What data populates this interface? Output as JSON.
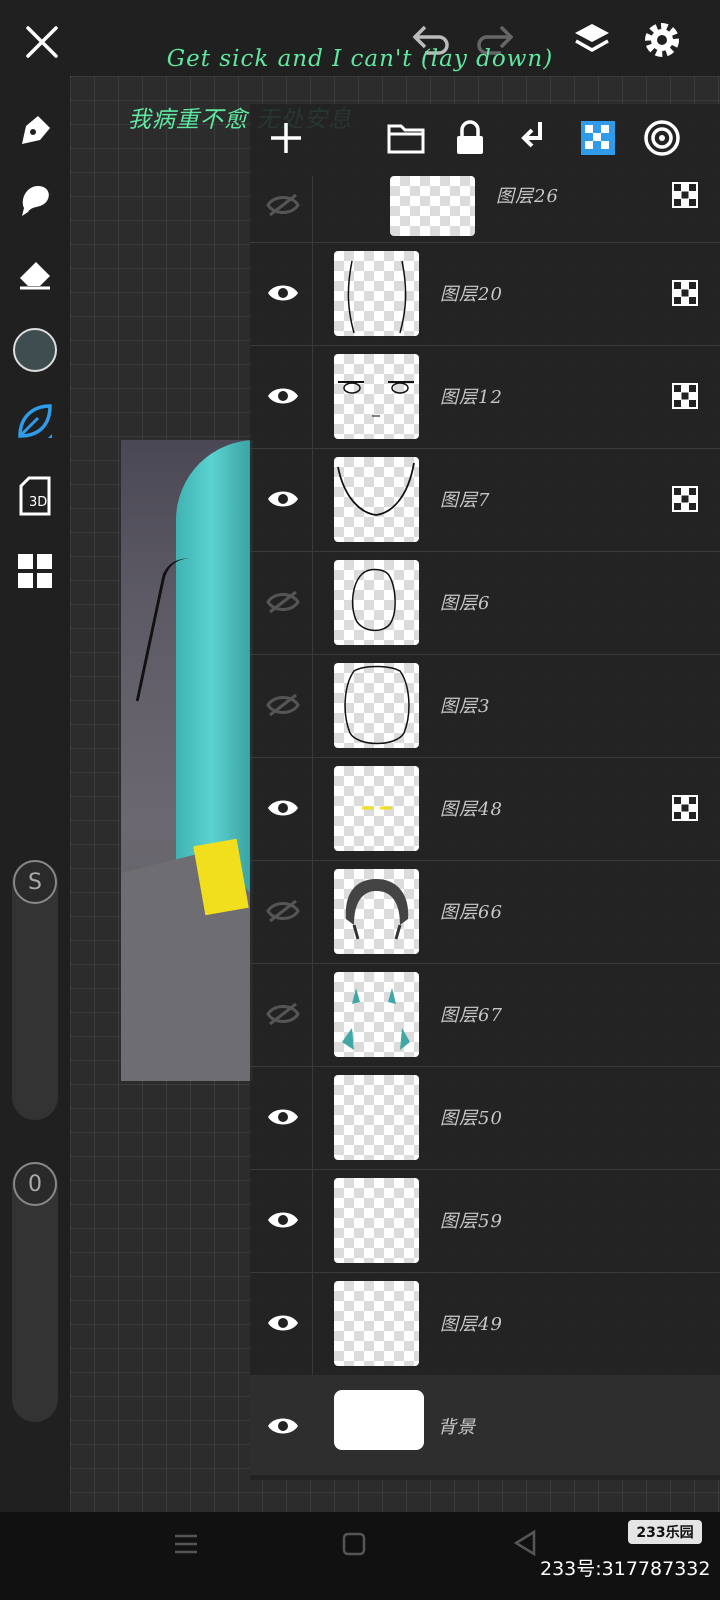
{
  "caption": {
    "english": "Get sick and I can't (lay down)",
    "chinese": "我病重不愈 无处安息"
  },
  "left_toolbar": {
    "current_color": "#3e4d50",
    "size_slider_label": "S",
    "opacity_slider_label": "0"
  },
  "layers": [
    {
      "name": "图层26",
      "visible": false,
      "clipping": true
    },
    {
      "name": "图层20",
      "visible": true,
      "clipping": true
    },
    {
      "name": "图层12",
      "visible": true,
      "clipping": true
    },
    {
      "name": "图层7",
      "visible": true,
      "clipping": true
    },
    {
      "name": "图层6",
      "visible": false,
      "clipping": false
    },
    {
      "name": "图层3",
      "visible": false,
      "clipping": false
    },
    {
      "name": "图层48",
      "visible": true,
      "clipping": true
    },
    {
      "name": "图层66",
      "visible": false,
      "clipping": false
    },
    {
      "name": "图层67",
      "visible": false,
      "clipping": false
    },
    {
      "name": "图层50",
      "visible": true,
      "clipping": false
    },
    {
      "name": "图层59",
      "visible": true,
      "clipping": false
    },
    {
      "name": "图层49",
      "visible": true,
      "clipping": false
    },
    {
      "name": "背景",
      "visible": true,
      "clipping": false
    }
  ],
  "watermark": {
    "logo": "233乐园",
    "id_text": "233号:317787332"
  },
  "colors": {
    "accent": "#2f9bea",
    "caption": "#5ee8a0"
  }
}
